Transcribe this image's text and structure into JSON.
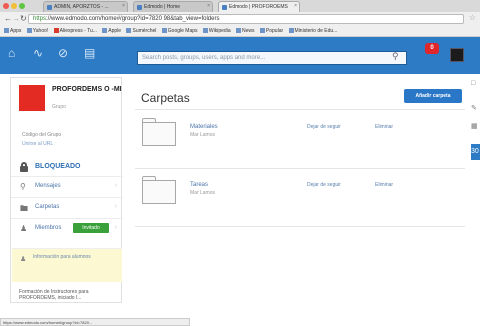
{
  "browser": {
    "tabs": [
      {
        "label": "ADMIN, APORZTOS - ..."
      },
      {
        "label": "Edmodo | Home"
      },
      {
        "label": "Edmodo | PROFOROEMS"
      }
    ],
    "url_scheme": "https",
    "url_rest": "://www.edmodo.com/home#/group?id=7820 98&tab_view=folders",
    "bookmarks": [
      "Apps",
      "Yahoo!",
      "Aliexpress - Tu...",
      "Apple",
      "Sumérchel",
      "Google Maps",
      "Wikipedia",
      "News",
      "Popular",
      "Ministerio de Edu..."
    ]
  },
  "topnav": {
    "search_placeholder": "Search posts, groups, users, apps and more...",
    "notification_count": "0"
  },
  "group": {
    "name": "PROFORDEMS O -MI",
    "subtitle": "Grupo",
    "code_label": "Código del Grupo",
    "code_link": "Unirse al URL",
    "locked_label": "BLOQUEADO",
    "menu": [
      {
        "label": "Mensajes"
      },
      {
        "label": "Carpetas"
      },
      {
        "label": "Miembros"
      }
    ],
    "invite_label": "Invitado",
    "notice": "Información para alumnos",
    "footnote": "Formación de Instructores para PROFORDEMS, iniciado l..."
  },
  "main": {
    "title": "Carpetas",
    "add_button": "Añadir carpeta",
    "folders": [
      {
        "name": "Materiales",
        "owner": "Mar Lamos",
        "unfollow": "Dejar de seguir",
        "delete": "Eliminar"
      },
      {
        "name": "Tareas",
        "owner": "Mar Lamos",
        "unfollow": "Dejar de seguir",
        "delete": "Eliminar"
      }
    ]
  },
  "rightbar": {
    "badge": "30"
  },
  "statusbar": {
    "text": "https://www.edmodo.com/home#/group?id=7820..."
  },
  "colors": {
    "nav_blue": "#2d7bc4",
    "alert_red": "#e32b24",
    "invite_green": "#3aa03a",
    "notice_yellow": "#fbf8d2"
  },
  "icons": [
    "home-icon",
    "activity-icon",
    "discover-icon",
    "library-icon",
    "search-icon",
    "lock-icon",
    "search-mag-icon",
    "folder-icon",
    "members-icon",
    "star-icon"
  ]
}
